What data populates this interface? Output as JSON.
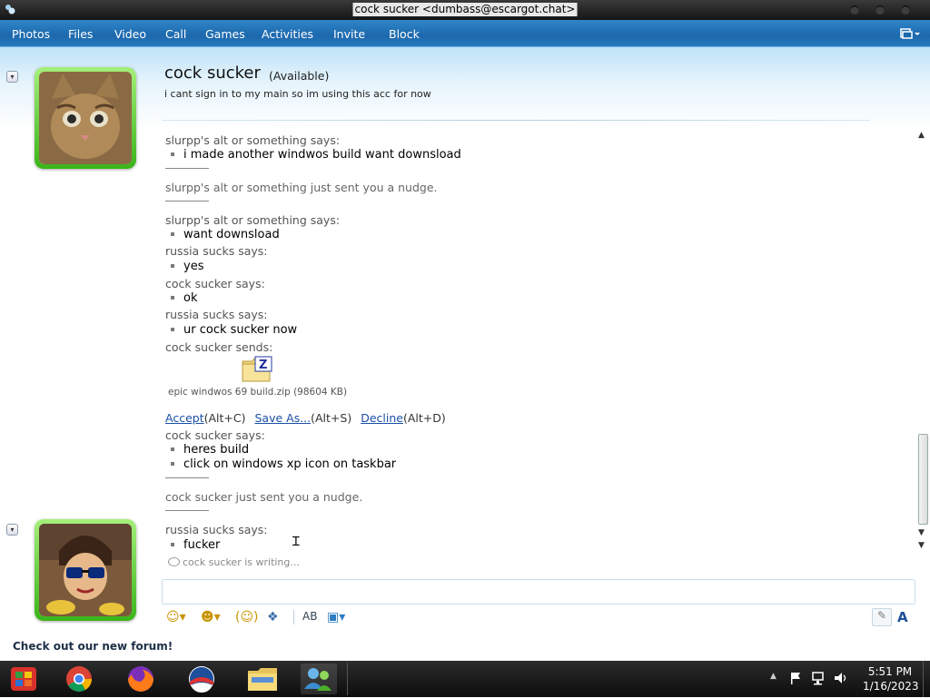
{
  "window": {
    "title": "cock sucker <dumbass@escargot.chat>"
  },
  "menu": [
    "Photos",
    "Files",
    "Video",
    "Call",
    "Games",
    "Activities",
    "Invite",
    "Block"
  ],
  "contact": {
    "name": "cock sucker",
    "status": "(Available)",
    "message": "i cant sign in to my main so im using this acc for now"
  },
  "chat": {
    "l1_sender": "slurpp's alt or something says:",
    "l1_msg": "i made another windwos build want downsload",
    "l2_nudge": "slurpp's alt or something just sent you a nudge.",
    "l3_sender": "slurpp's alt or something says:",
    "l3_msg": "want downsload",
    "l4_sender": "russia sucks says:",
    "l4_msg": "yes",
    "l5_sender": "cock sucker says:",
    "l5_msg": "ok",
    "l6_sender": "russia sucks says:",
    "l6_msg": "ur cock sucker now",
    "l7_sender": "cock sucker sends:",
    "file_name": "epic windwos 69 build.zip (98604 KB)",
    "accept": "Accept",
    "accept_key": "(Alt+C)",
    "saveas": "Save As...",
    "saveas_key": "(Alt+S)",
    "decline": "Decline",
    "decline_key": "(Alt+D)",
    "l8_sender": "cock sucker says:",
    "l8_msg1": "heres build",
    "l8_msg2": "click on windows xp icon on taskbar",
    "l9_nudge": "cock sucker just sent you a nudge.",
    "l10_sender": "russia sucks says:",
    "l10_msg": "fucker",
    "typing": "cock sucker is writing..."
  },
  "footer": {
    "forum": "Check out our new forum!"
  },
  "clock": {
    "time": "5:51 PM",
    "date": "1/16/2023"
  },
  "icons": [
    "smiley-icon",
    "wink-icon",
    "emoticon-icon",
    "nudge-icon",
    "font-icon",
    "background-icon",
    "handwriting-icon",
    "text-style-icon"
  ]
}
